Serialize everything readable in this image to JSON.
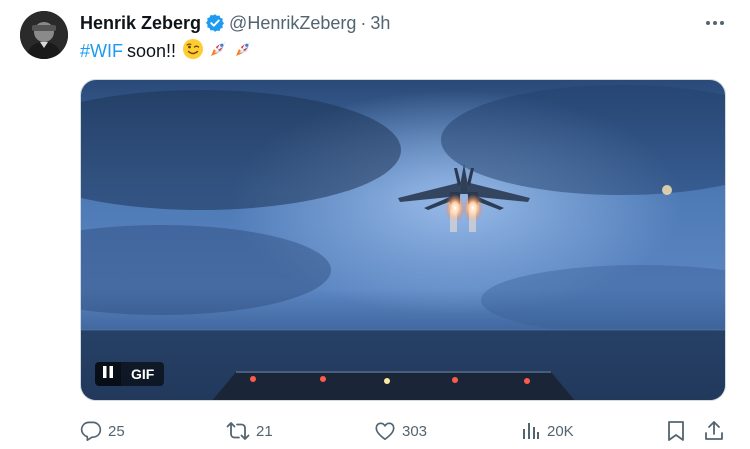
{
  "author": {
    "display_name": "Henrik Zeberg",
    "handle": "@HenrikZeberg",
    "separator": "·",
    "time": "3h",
    "verified": true
  },
  "post": {
    "hashtag": "#WIF",
    "text": "soon!!",
    "emojis": [
      "winking-face-emoji",
      "rocket-emoji",
      "rocket-emoji"
    ]
  },
  "media": {
    "badge": "GIF",
    "state": "playing"
  },
  "actions": {
    "replies": "25",
    "reposts": "21",
    "likes": "303",
    "views": "20K"
  },
  "colors": {
    "accent": "#1d9bf0",
    "secondary_text": "#536471",
    "primary_text": "#0f1419"
  }
}
